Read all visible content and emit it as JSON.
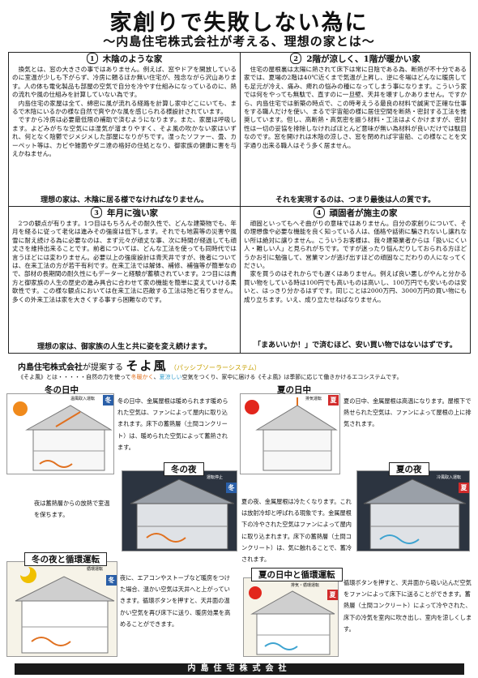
{
  "header": {
    "title": "家創りで失敗しない為に",
    "subtitle": "～内島住宅株式会社が考える、理想の家とは～"
  },
  "sections": [
    {
      "number": "1",
      "title": "木陰のような家",
      "paragraphs": [
        "換気とは、窓の大きさの事ではありません。例えば、窓やドアを開放しているのに室温が少しも下がらず、冷房に頼るほか無い住宅が、残念ながら沢山あります。人の体も電化製品も部屋の空気で自分を冷やす仕組みになっているのに、熱の流れや風の仕組みを計算していない為です。",
        "内島住宅の家屋は全て、綿密に風が流れる経路を計算し家中どこにいても、まるで木陰にいるかの様な自然で爽やかな風を感じられる様設計されています。",
        "ですから冷房は必要最低限の補助で済むようになります。また、家屋は呼吸します。よどみがちな空気には湿気が溜まりやすく、そよ風の吹かない家はいずれ、何となく陰鬱でジメジメした部屋になりがちです。湿ったソファー、畳、カーペット等は、カビや雑菌やダニ達の格好の住処となり、御家族の健康に害を与えかねません。"
      ],
      "footer": "理想の家は、木陰に居る様でなければなりません。"
    },
    {
      "number": "2",
      "title": "2階が涼しく、1階が暖かい家",
      "paragraphs": [
        "住宅の屋根裏は太陽に熱されて床下は常に日陰である為、断熱が不十分である家では、夏場の2階は40℃近くまで気温が上昇し、逆に冬場はどんなに暖房しても足元が冷え、痛み、痺れの悩みの種になってしまう事になります。こういう家では何をやっても無駄で、直すのに一旦壁、天井を壊すしかありません。ですから、内島住宅では新築の時点で、この時考えうる最良の材料で誠実で正確な仕事をする職人だけを使い、まるで宇宙船の様に居住空間を断熱・密封する工法を推奨しています。但し、高断熱・高気密を謳う材料・工法はよくかけますが、密封性は一切の妥協を排除しなければほとんど意味が無い為材料が良いだけでは駄目なのです。窓を開けれは木陰の涼しさ、窓を閉めれば宇宙船、この様なことを文字通り出来る職人はそう多く居ません。"
      ],
      "footer": "それを実現するのは、つまり最後は人の質です。"
    },
    {
      "number": "3",
      "title": "年月に強い家",
      "paragraphs": [
        "2つの観点が有ります。1つ目はもちろんその耐久性で、どんな建築物でも、年月を経るに従って老化は進みその強度は低下します。それでも地震等の災害や風雪に耐え続ける為に必要なのは、まず元々が頑丈な事、次に時間が経過しても頑丈さを維持出来ることです。前者については、どんな工法を使っても同時代では言うほどには変わりません。必要以上の強度設計は青天井ですが、後者については、在来工法の方が若干有利です。在来工法では解体、補修、補強等が簡単なので、部材の長期間の耐久性にもデーターと経験が蓄積されています。2つ目には貴方と御家族の人生の歴史の進み具合に合わせて家の機能を簡単に変えていける柔軟性です。この様な観点においては在来工法に匹敵する工法は殆ど有りません。多くの外来工法は家を大きくする事すら困難なのです。"
      ],
      "footer": "理想の家は、御家族の人生と共に姿を変え続けます。"
    },
    {
      "number": "4",
      "title": "頑固者が施主の家",
      "paragraphs": [
        "頑固といってもへそ曲がりの意味ではありません。自分の家創りについて、その理想像や必要な機能を良く知っている人は、価格や話術に騙されないし譲れない所は絶対に譲りません。こういうお客様は、我々建築業者からは「扱いにくい人・難しい人」と見られがちです。ですが迷ったり悩んだりしておられる方ほどうかお引に勉強して、営業マンが逃げ出すほどの頑固なこだわりの人になってください。",
        "家を買うのはそれからでも遅くはありません。例えば良い悪しがやんと分かる買い物をしている時は100円でも高いものは高いし、100万円でも安いものは安いと、はっきり分かるはずです。同じことは2000万円、3000万円の買い物にも成り立ちます。いえ、成り立たせねばなりません。"
      ],
      "footer": "「まあいいか！」で済むほど、安い買い物ではないはずです。"
    }
  ],
  "soyokaze": {
    "company": "内島住宅株式会社",
    "propose": "が提案する",
    "name": "そよ風",
    "kana": "（パッシブソーラーシステム）",
    "desc_before": "《そよ風》とは・・・・・自然の力を使って",
    "desc_warm": "冬暖かく",
    "desc_sep": "、",
    "desc_cool": "夏涼しい",
    "desc_after": "空気をつくり、家中に届ける《そよ風》は季節に応じて働きかけるエコシステムです。",
    "panels": [
      {
        "title": "冬の日中",
        "badge": "冬",
        "mode": "温風取入運転",
        "text": "冬の日中、金属屋根は暖められます暖められた空気は、ファンによって屋内に取り込まれます。床下の蓄熱層（土間コンクリート）は、暖められた空気によって蓄熱されます。"
      },
      {
        "title": "夏の日中",
        "badge": "夏",
        "mode": "排気運転",
        "text": "夏の日中、金属屋根は高温になります。屋根下で熱せられた空気は、ファンによって屋根の上に排気されます。"
      },
      {
        "title": "冬の夜",
        "badge": "冬",
        "mode": "運転停止",
        "text": "夜は蓄熱層からの放熱で室温を保ちます。"
      },
      {
        "title": "夏の夜",
        "badge": "夏",
        "mode": "冷風取入運転",
        "text": "夏の夜、金属屋根は冷たくなります。これは放射冷却と呼ばれる現象です。金属屋根下の冷やされた空気はファンによって屋内に取り込まれます。床下の蓄熱層（土間コンクリート）は、気に触れることで、蓄冷されます。"
      },
      {
        "title": "冬の夜と循環運転",
        "badge": "冬",
        "mode": "循環運転",
        "text": "夜に、エアコンやストーブなど暖房をつけた場合、温かい空気は天井へと上がっていきます。循環ボタンを押すと、天井面の温かい空気を再び床下に送り、暖房効果を高めることができます。"
      },
      {
        "title": "夏の日中と循環運転",
        "badge": "夏",
        "mode": "排気・循環運転",
        "text": "循環ボタンを押すと、天井面から吸い込んだ空気をファンによって床下に送ることができます。蓄熱層（土間コンクリート）によって冷やされた、床下の冷気を室内に吹き出し、室内を涼しくします。"
      }
    ]
  },
  "footer": {
    "company": "内島住宅株式会社"
  }
}
